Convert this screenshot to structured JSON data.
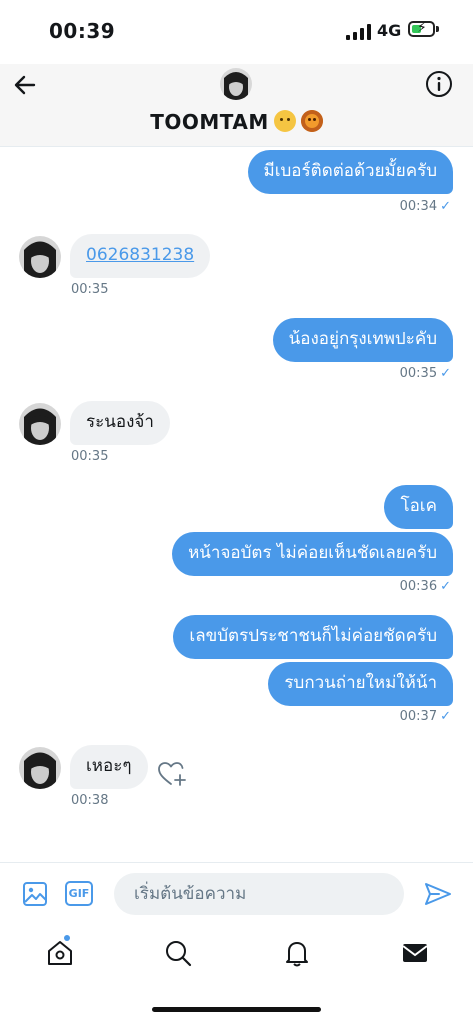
{
  "status_bar": {
    "time": "00:39",
    "network": "4G"
  },
  "header": {
    "title": "TOOMTAM"
  },
  "messages": {
    "m1": {
      "text": "มีเบอร์ติดต่อด้วยมั้ยครับ",
      "time": "00:34"
    },
    "m2": {
      "text": "0626831238",
      "time": "00:35"
    },
    "m3": {
      "text": "น้องอยู่กรุงเทพปะคับ",
      "time": "00:35"
    },
    "m4": {
      "text": "ระนองจ้า",
      "time": "00:35"
    },
    "m5": {
      "text": "โอเค"
    },
    "m6": {
      "text": "หน้าจอบัตร ไม่ค่อยเห็นชัดเลยครับ",
      "time": "00:36"
    },
    "m7": {
      "text": "เลขบัตรประชาชนก็ไม่ค่อยชัดครับ"
    },
    "m8": {
      "text": "รบกวนถ่ายใหม่ให้น้า",
      "time": "00:37"
    },
    "m9": {
      "text": "เหอะๆ",
      "time": "00:38"
    }
  },
  "composer": {
    "placeholder": "เริ่มต้นข้อความ",
    "gif_label": "GIF",
    "icons": [
      "image-icon",
      "gif-icon",
      "send-icon"
    ]
  },
  "tabbar": {
    "icons": [
      "home-icon",
      "search-icon",
      "bell-icon",
      "mail-icon"
    ]
  },
  "colors": {
    "accent": "#4a99e9",
    "incoming_bubble": "#eff1f3",
    "text": "#14171a",
    "muted": "#657786"
  }
}
